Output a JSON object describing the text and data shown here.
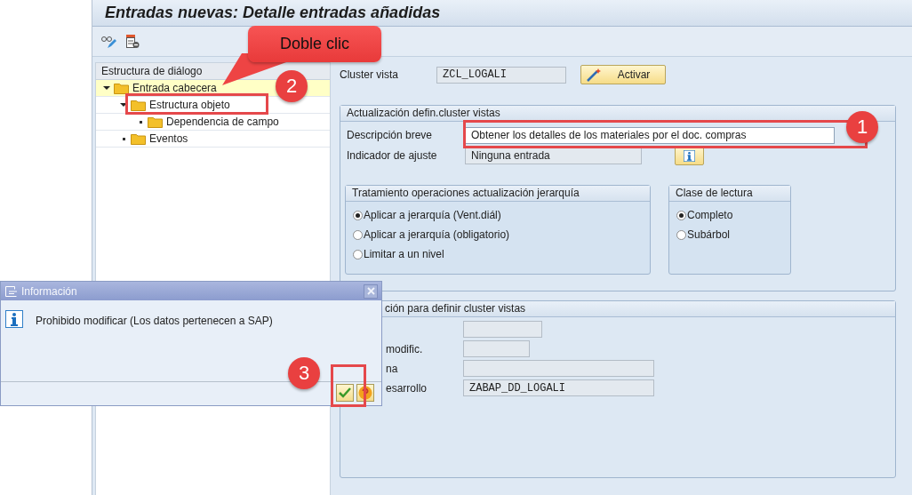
{
  "title": "Entradas nuevas: Detalle entradas añadidas",
  "tree": {
    "header": "Estructura de diálogo",
    "items": [
      {
        "label": "Entrada cabecera",
        "expanded": true,
        "selected": true,
        "children": [
          {
            "label": "Estructura objeto",
            "expanded": true,
            "selected": false,
            "children": [
              {
                "label": "Dependencia de campo",
                "selected": false
              }
            ]
          },
          {
            "label": "Eventos",
            "selected": false
          }
        ]
      }
    ]
  },
  "cluster": {
    "label": "Cluster vista",
    "value": "ZCL_LOGALI",
    "button": "Activar"
  },
  "update_group": {
    "title": "Actualización defin.cluster vistas",
    "fields": [
      {
        "label": "Descripción breve",
        "value": "Obtener los detalles de los materiales por el doc. compras",
        "kind": "editable"
      },
      {
        "label": "Indicador de ajuste",
        "value": "Ninguna entrada",
        "kind": "readonly"
      }
    ]
  },
  "hierarchy": {
    "title": "Tratamiento operaciones actualización jerarquía",
    "options": [
      {
        "label": "Aplicar a jerarquía (Vent.diál)",
        "selected": true
      },
      {
        "label": "Aplicar a jerarquía (obligatorio)",
        "selected": false
      },
      {
        "label": "Limitar a un nivel",
        "selected": false
      }
    ]
  },
  "read_class": {
    "title": "Clase de lectura",
    "options": [
      {
        "label": "Completo",
        "selected": true
      },
      {
        "label": "Subárbol",
        "selected": false
      }
    ]
  },
  "info_group": {
    "title": "ción para definir cluster vistas",
    "fields": [
      {
        "kind": "medium"
      },
      {
        "label": "modific.",
        "kind": "small"
      },
      {
        "label": "na",
        "kind": "large"
      },
      {
        "label": "esarrollo",
        "value": "ZABAP_DD_LOGALI",
        "kind": "large"
      }
    ]
  },
  "dialog": {
    "title": "Información",
    "message": "Prohibido modificar (Los datos pertenecen a SAP)"
  },
  "callout": {
    "text": "Doble clic"
  },
  "steps": [
    "1",
    "2",
    "3"
  ]
}
